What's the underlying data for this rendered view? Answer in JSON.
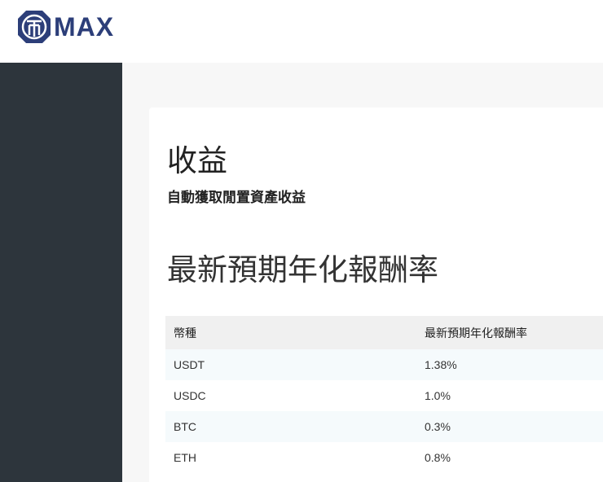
{
  "header": {
    "logo_text": "MAX",
    "logo_icon": "max-coin-logo-icon",
    "brand_color": "#2c3e79"
  },
  "sidebar": {
    "background": "#2d353c"
  },
  "page": {
    "title": "收益",
    "subtitle": "自動獲取閒置資產收益",
    "section_title": "最新預期年化報酬率"
  },
  "rates_table": {
    "headers": {
      "coin": "幣種",
      "rate": "最新預期年化報酬率"
    },
    "rows": [
      {
        "coin": "USDT",
        "rate": "1.38%"
      },
      {
        "coin": "USDC",
        "rate": "1.0%"
      },
      {
        "coin": "BTC",
        "rate": "0.3%"
      },
      {
        "coin": "ETH",
        "rate": "0.8%"
      }
    ]
  }
}
